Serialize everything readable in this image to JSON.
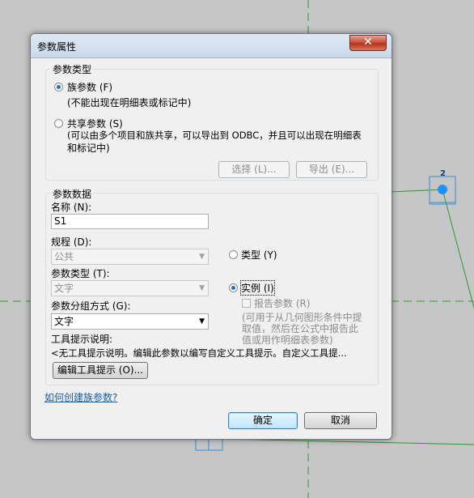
{
  "dialog": {
    "title": "参数属性",
    "close_glyph": "✕"
  },
  "param_type_group": {
    "title": "参数类型",
    "family_param": {
      "label": "族参数 (F)",
      "note": "(不能出现在明细表或标记中)",
      "selected": true
    },
    "shared_param": {
      "label": "共享参数 (S)",
      "note_line1": "(可以由多个项目和族共享，可以导出到 ODBC，并且可以出现在明细表",
      "note_line2": "和标记中)",
      "selected": false
    },
    "select_button": "选择 (L)...",
    "export_button": "导出 (E)..."
  },
  "param_data_group": {
    "title": "参数数据",
    "name_label": "名称 (N):",
    "name_value": "S1",
    "discipline_label": "规程 (D):",
    "discipline_value": "公共",
    "param_type_label": "参数类型 (T):",
    "param_type_value": "文字",
    "group_label": "参数分组方式 (G):",
    "group_value": "文字",
    "tooltip_label": "工具提示说明:",
    "tooltip_value": "<无工具提示说明。编辑此参数以编写自定义工具提示。自定义工具提...",
    "edit_tooltip_button": "编辑工具提示 (O)...",
    "type_radio": {
      "label": "类型 (Y)",
      "selected": false
    },
    "instance_radio": {
      "label": "实例 (I)",
      "selected": true
    },
    "report_param": {
      "label": "报告参数 (R)",
      "checked": false,
      "note_line1": "(可用于从几何图形条件中提",
      "note_line2": "取值，然后在公式中报告此",
      "note_line3": "值或用作明细表参数)"
    }
  },
  "help_link": "如何创建族参数?",
  "footer": {
    "ok_button": "确定",
    "cancel_button": "取消"
  },
  "canvas": {
    "marker_label": "2",
    "background_color": "#c6c6c6",
    "line_color": "#2a9a2a",
    "marker_color": "#1e90ff"
  }
}
